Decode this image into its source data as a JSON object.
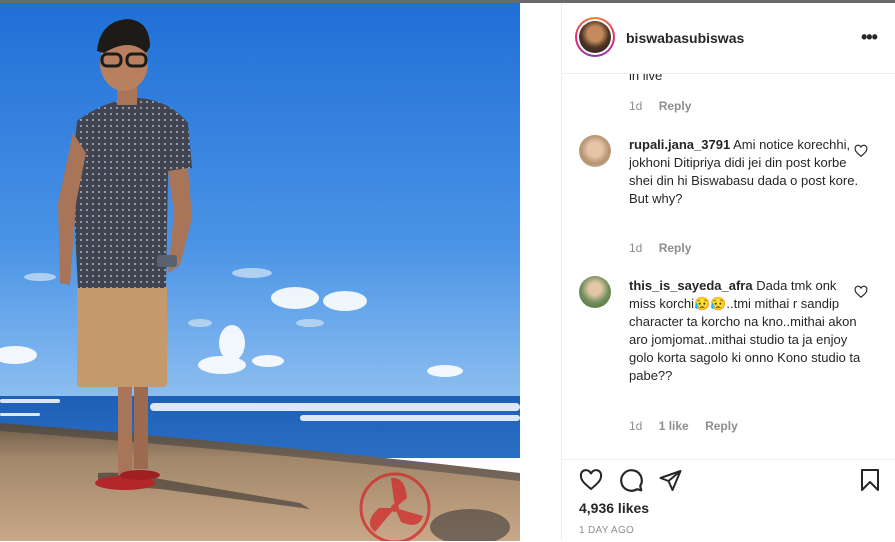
{
  "post": {
    "username": "biswabasubiswas",
    "more_label": "•••"
  },
  "comments": [
    {
      "user": "",
      "text": "in live",
      "time": "1d",
      "likes": "",
      "reply": "Reply"
    },
    {
      "user": "rupali.jana_3791",
      "text": "Ami notice korechhi, jokhoni Ditipriya didi jei din post korbe shei din hi Biswabasu dada o post kore. But why?",
      "time": "1d",
      "likes": "",
      "reply": "Reply"
    },
    {
      "user": "this_is_sayeda_afra",
      "text": "Dada tmk onk miss korchi😥😥..tmi mithai r sandip character ta korcho na kno..mithai akon aro jomjomat..mithai studio ta ja enjoy golo korta sagolo ki onno Kono studio ta pabe??",
      "time": "1d",
      "likes": "1 like",
      "reply": "Reply"
    }
  ],
  "footer": {
    "likes": "4,936 likes",
    "posted_ago": "1 DAY AGO"
  },
  "icons": [
    "heart-icon",
    "comment-icon",
    "share-icon",
    "bookmark-icon",
    "more-icon"
  ]
}
